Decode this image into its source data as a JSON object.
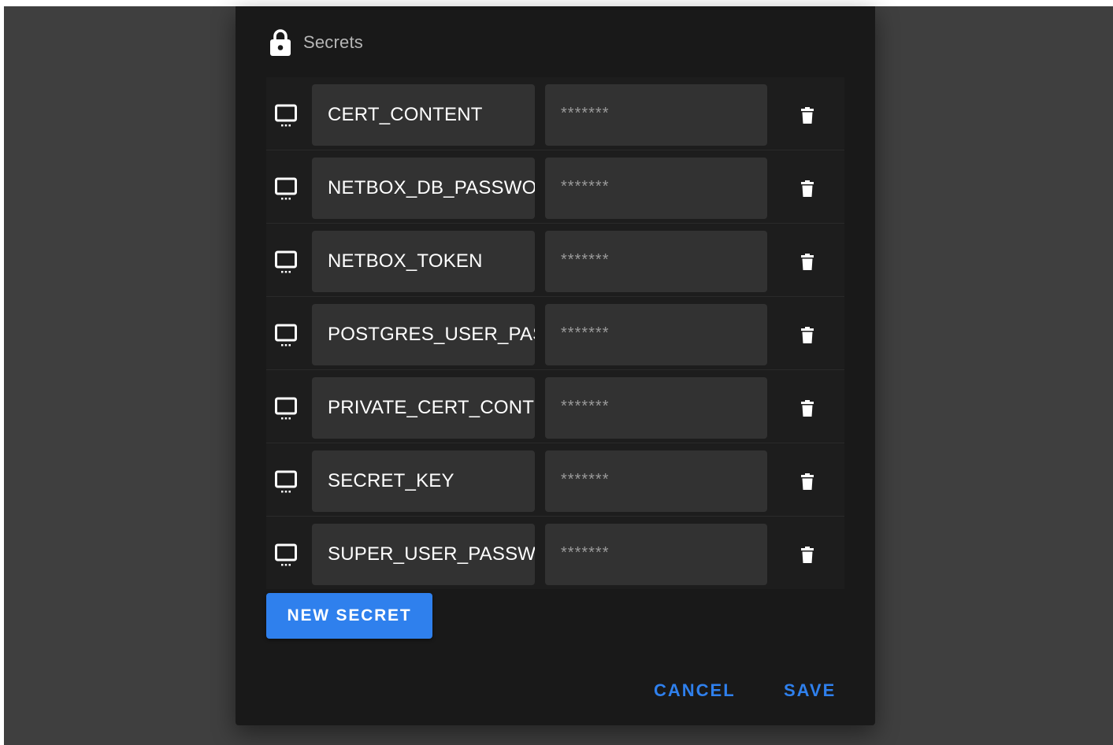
{
  "dialog": {
    "title": "Secrets",
    "icons": {
      "header": "lock-icon",
      "row": "monitor-icon",
      "delete": "trash-icon"
    },
    "secrets": [
      {
        "key": "CERT_CONTENT",
        "value": "*******"
      },
      {
        "key": "NETBOX_DB_PASSWORD",
        "value": "*******"
      },
      {
        "key": "NETBOX_TOKEN",
        "value": "*******"
      },
      {
        "key": "POSTGRES_USER_PASSWORD",
        "value": "*******"
      },
      {
        "key": "PRIVATE_CERT_CONTENT",
        "value": "*******"
      },
      {
        "key": "SECRET_KEY",
        "value": "*******"
      },
      {
        "key": "SUPER_USER_PASSWORD",
        "value": "*******"
      }
    ],
    "new_secret_label": "NEW SECRET",
    "cancel_label": "CANCEL",
    "save_label": "SAVE"
  },
  "colors": {
    "backdrop": "#3f3f3f",
    "dialog": "#191919",
    "field": "#323232",
    "accent": "#2f80ed"
  }
}
